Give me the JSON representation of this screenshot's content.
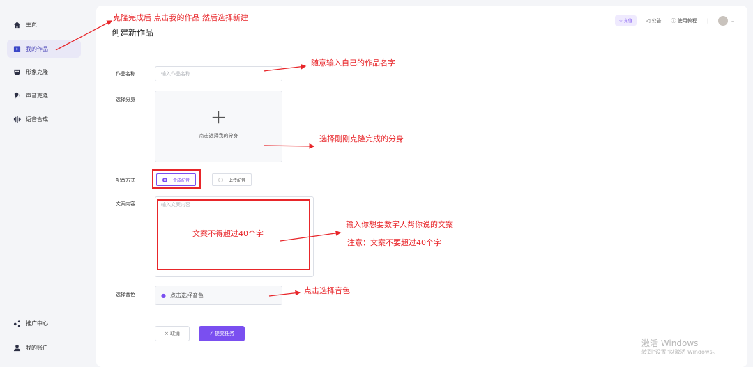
{
  "sidebar": {
    "items": [
      {
        "label": "主页",
        "icon": "home-icon"
      },
      {
        "label": "我的作品",
        "icon": "play-icon"
      },
      {
        "label": "形象克隆",
        "icon": "mask-icon"
      },
      {
        "label": "声音克隆",
        "icon": "voice-icon"
      },
      {
        "label": "语音合成",
        "icon": "waveform-icon"
      }
    ],
    "bottom": [
      {
        "label": "推广中心",
        "icon": "share-icon"
      },
      {
        "label": "我的账户",
        "icon": "user-icon"
      }
    ]
  },
  "header": {
    "recharge": "充值",
    "announcement": "公告",
    "tutorial": "使用教程"
  },
  "page": {
    "title": "创建新作品"
  },
  "form": {
    "name_label": "作品名称",
    "name_placeholder": "输入作品名称",
    "avatar_label": "选择分身",
    "avatar_text": "点击选择我的分身",
    "dub_label": "配音方式",
    "dub_option_synth": "合成配音",
    "dub_option_upload": "上传配音",
    "content_label": "文案内容",
    "content_placeholder": "输入文案内容",
    "voice_label": "选择音色",
    "voice_text": "点击选择音色",
    "cancel": "× 取消",
    "submit": "✓ 提交任务"
  },
  "annotations": {
    "step1": "克隆完成后  点击我的作品  然后选择新建",
    "name": "随意输入自己的作品名字",
    "avatar": "选择刚刚克隆完成的分身",
    "text_limit": "文案不得超过40个字",
    "text_input": "输入你想要数字人帮你说的文案",
    "text_note": "注意：文案不要超过40个字",
    "voice": "点击选择音色"
  },
  "watermark": {
    "line1": "激活 Windows",
    "line2": "转到\"设置\"以激活 Windows。"
  },
  "colors": {
    "accent": "#7a4ff0",
    "annotation": "#e8262a"
  }
}
